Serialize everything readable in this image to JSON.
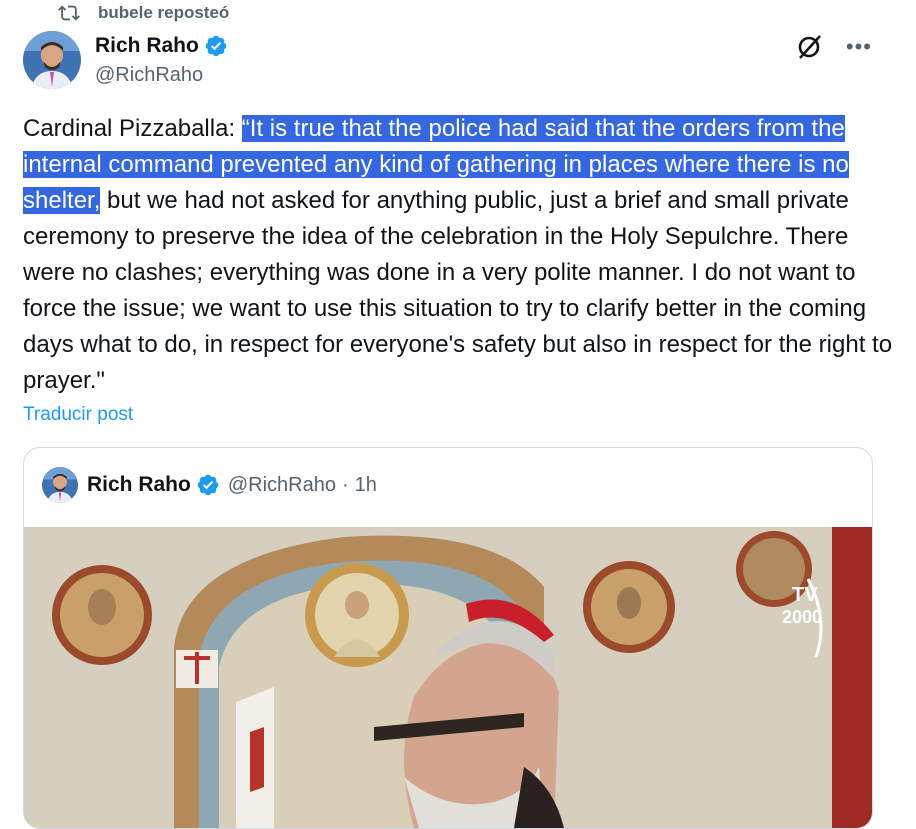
{
  "repost": {
    "label": "bubele reposteó",
    "icon": "repost-icon"
  },
  "author": {
    "name": "Rich Raho",
    "handle": "@RichRaho",
    "verified_color": "#1d9bf0"
  },
  "actions": {
    "grok_icon": "grok-icon",
    "more_label": "•••"
  },
  "tweet": {
    "prefix": "Cardinal Pizzaballa: ",
    "highlighted": "“It is true that the police had said that the orders from the internal command prevented any kind of gathering in places where there is no shelter,",
    "rest": " but we had not asked for anything public, just a brief and small private ceremony to preserve the idea of the celebration in the Holy Sepulchre. There were no clashes; everything was done in a very polite manner. I do not want to force the issue; we want to use this situation to try to clarify better in the coming days what to do, in respect for everyone's safety but also in respect for the right to prayer.\"",
    "highlight_color": "#3567e0"
  },
  "translate_label": "Traducir post",
  "quote": {
    "name": "Rich Raho",
    "handle": "@RichRaho",
    "separator": "·",
    "time": "1h",
    "watermark": "TV2000"
  },
  "colors": {
    "link": "#1d9bf0",
    "secondary": "#536471",
    "border": "#cfd9de"
  }
}
